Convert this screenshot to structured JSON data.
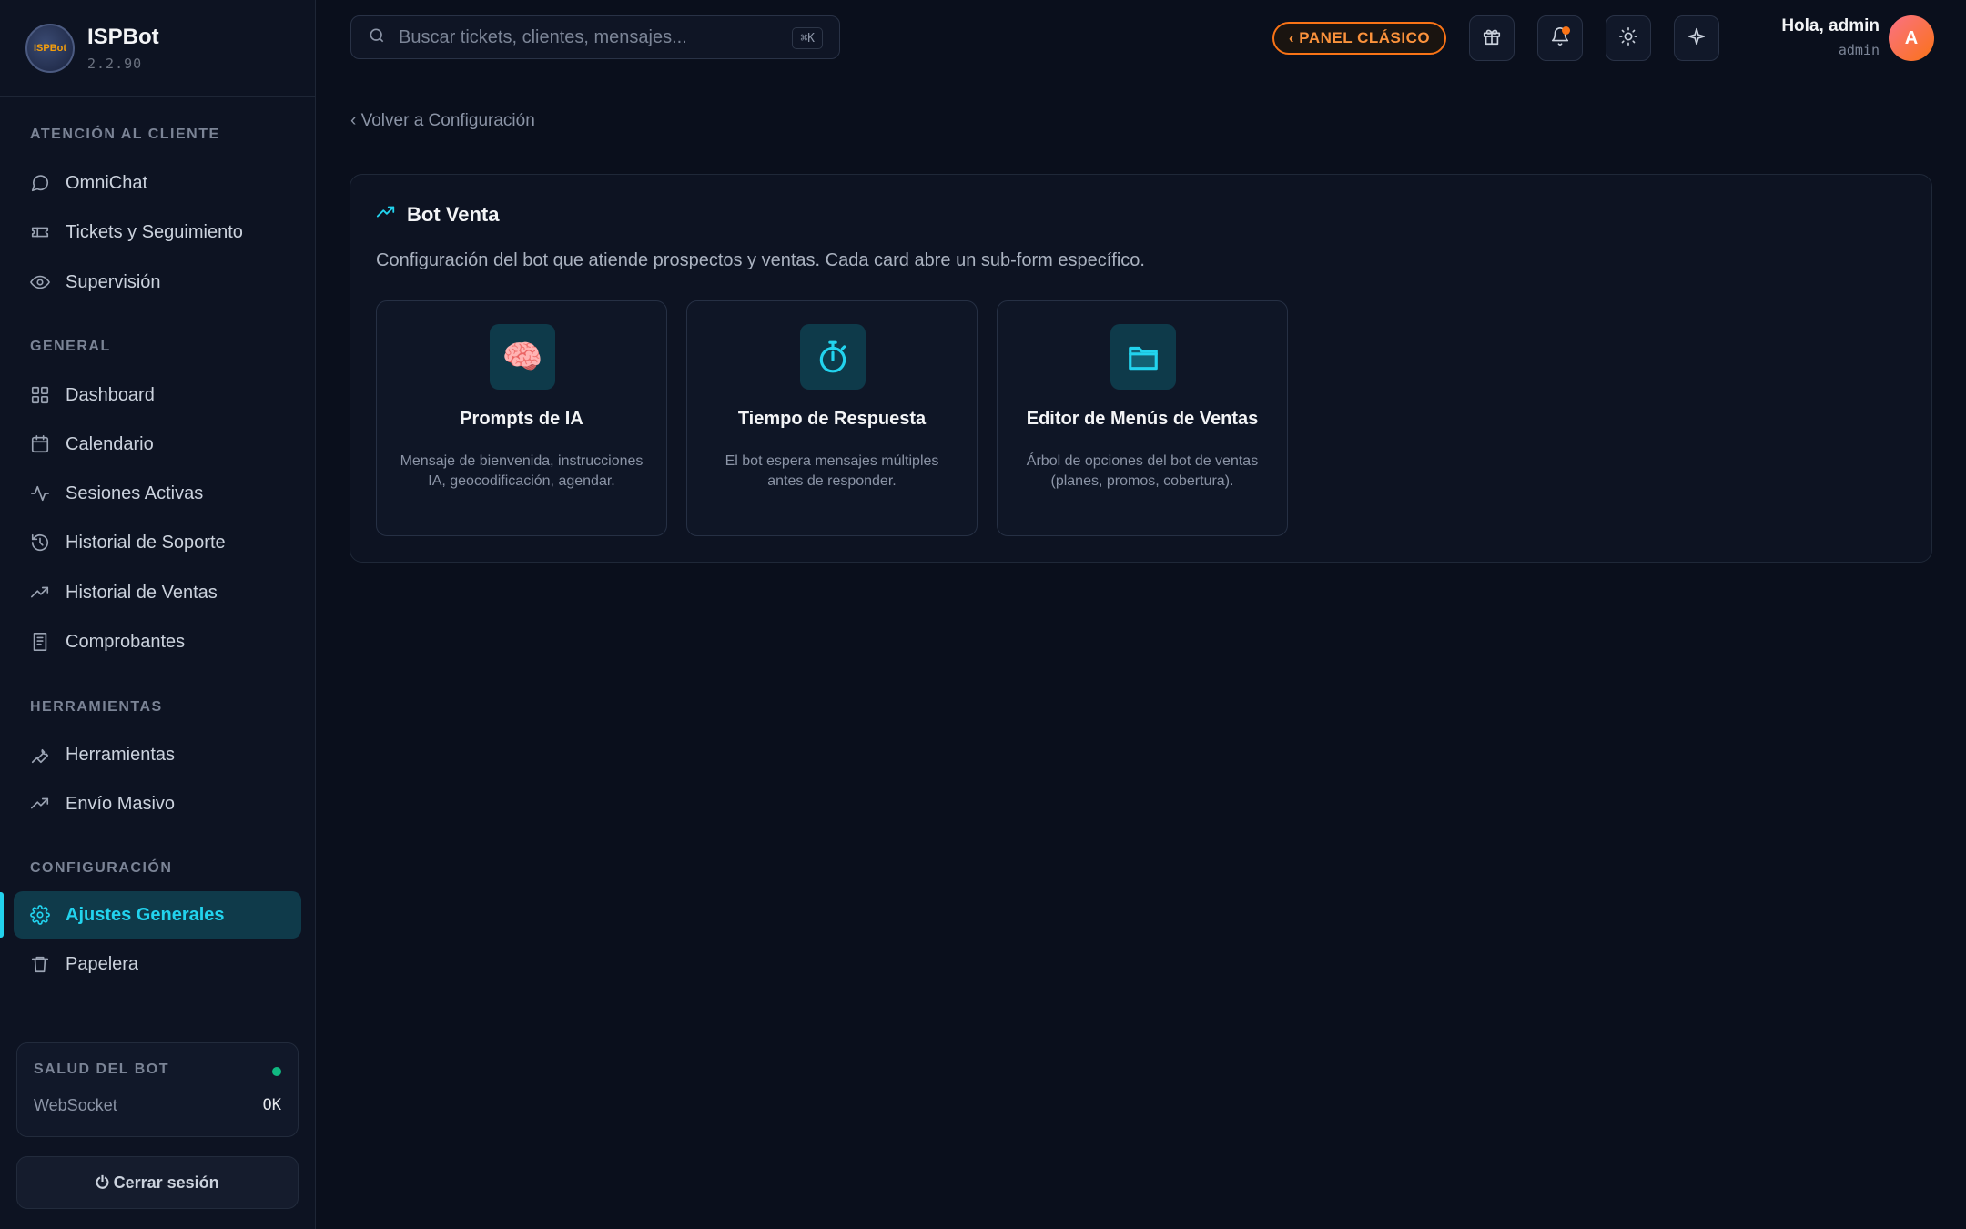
{
  "brand": {
    "name": "ISPBot",
    "version": "2.2.90",
    "logo_text": "ISPBot"
  },
  "sidebar": {
    "sections": [
      {
        "title": "ATENCIÓN AL CLIENTE",
        "items": [
          {
            "label": "OmniChat",
            "icon": "chat-icon"
          },
          {
            "label": "Tickets y Seguimiento",
            "icon": "ticket-icon"
          },
          {
            "label": "Supervisión",
            "icon": "eye-icon"
          }
        ]
      },
      {
        "title": "GENERAL",
        "items": [
          {
            "label": "Dashboard",
            "icon": "grid-icon"
          },
          {
            "label": "Calendario",
            "icon": "calendar-icon"
          },
          {
            "label": "Sesiones Activas",
            "icon": "activity-icon"
          },
          {
            "label": "Historial de Soporte",
            "icon": "history-icon"
          },
          {
            "label": "Historial de Ventas",
            "icon": "trending-up-icon"
          },
          {
            "label": "Comprobantes",
            "icon": "receipt-icon"
          }
        ]
      },
      {
        "title": "HERRAMIENTAS",
        "items": [
          {
            "label": "Herramientas",
            "icon": "wrench-icon"
          },
          {
            "label": "Envío Masivo",
            "icon": "trending-up-icon"
          }
        ]
      },
      {
        "title": "CONFIGURACIÓN",
        "items": [
          {
            "label": "Ajustes Generales",
            "icon": "gear-icon",
            "active": true
          },
          {
            "label": "Papelera",
            "icon": "trash-icon"
          }
        ]
      }
    ],
    "health": {
      "title": "SALUD DEL BOT",
      "label": "WebSocket",
      "value": "OK",
      "status_color": "#10b981"
    },
    "logout_label": "⏻ Cerrar sesión"
  },
  "topbar": {
    "search_placeholder": "Buscar tickets, clientes, mensajes...",
    "search_shortcut": "⌘K",
    "classic_label": "‹ PANEL CLÁSICO",
    "greeting": "Hola, admin",
    "role": "admin",
    "avatar_initial": "A"
  },
  "main": {
    "back_link": "‹ Volver a Configuración",
    "panel_title": "Bot Venta",
    "panel_description": "Configuración del bot que atiende prospectos y ventas. Cada card abre un sub-form específico.",
    "cards": [
      {
        "title": "Prompts de IA",
        "description": "Mensaje de bienvenida, instrucciones IA, geocodificación, agendar.",
        "icon": "brain-icon"
      },
      {
        "title": "Tiempo de Respuesta",
        "description": "El bot espera mensajes múltiples antes de responder.",
        "icon": "stopwatch-icon"
      },
      {
        "title": "Editor de Menús de Ventas",
        "description": "Árbol de opciones del bot de ventas (planes, promos, cobertura).",
        "icon": "folder-icon"
      }
    ]
  },
  "colors": {
    "accent": "#22d3ee",
    "warning": "#f97316",
    "background": "#0a0f1c"
  }
}
